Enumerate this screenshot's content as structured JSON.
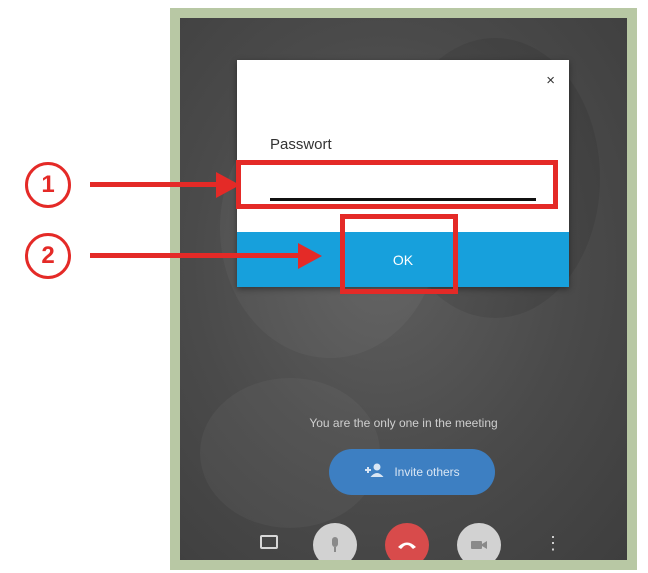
{
  "dialog": {
    "close_symbol": "×",
    "password_label": "Passwort",
    "password_value": "",
    "ok_label": "OK"
  },
  "meeting": {
    "status_text": "You are the only one in the meeting",
    "invite_label": "Invite others"
  },
  "toolbar": {
    "icons": [
      "chat-icon",
      "microphone-icon",
      "hang-up-icon",
      "camera-icon",
      "more-icon"
    ]
  },
  "annotations": {
    "marker_1": "1",
    "marker_2": "2",
    "color": "#e42a27"
  },
  "colors": {
    "ok_bar": "#17a0dc",
    "invite_button": "#3d7fc2",
    "hangup_button": "#d84b4b",
    "frame": "#b8c8a4"
  }
}
